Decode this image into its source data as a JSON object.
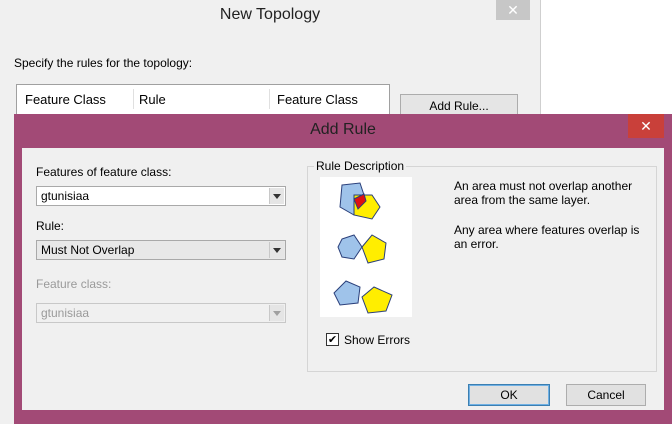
{
  "background_window": {
    "title": "New Topology",
    "close_symbol": "✕",
    "instruction": "Specify the rules for the topology:",
    "table_columns": [
      "Feature Class",
      "Rule",
      "Feature Class"
    ],
    "add_rule_button": "Add Rule..."
  },
  "dialog": {
    "title": "Add Rule",
    "close_symbol": "✕",
    "features_label": "Features of feature class:",
    "features_value": "gtunisiaa",
    "rule_label": "Rule:",
    "rule_value": "Must Not Overlap",
    "feature_class_label": "Feature class:",
    "feature_class_value": "gtunisiaa",
    "rule_description_title": "Rule Description",
    "description_line1": "An area must not overlap another area from the same layer.",
    "description_line2": "Any area where features overlap is an error.",
    "show_errors_label": "Show Errors",
    "show_errors_checked": true,
    "ok_button": "OK",
    "cancel_button": "Cancel"
  },
  "colors": {
    "dialog_frame": "#a24a76",
    "close_red": "#c9403a",
    "polygon_blue": "#9fc3ea",
    "polygon_yellow": "#ffee00",
    "error_red": "#e01010"
  },
  "icons": {
    "checkbox": "checkmark-icon",
    "dropdown": "chevron-down-icon",
    "close": "close-icon"
  }
}
